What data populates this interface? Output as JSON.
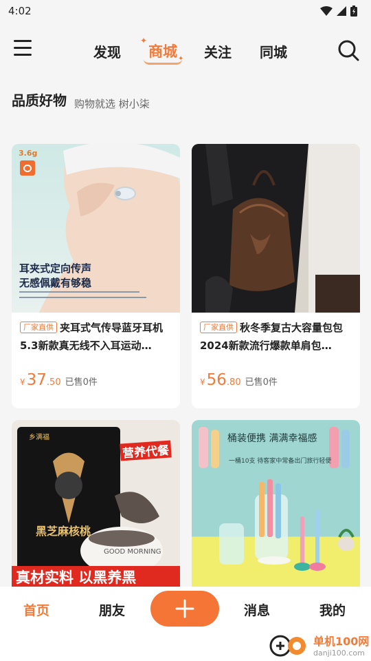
{
  "status_bar": {
    "time": "4:02"
  },
  "top_nav": {
    "tabs": [
      {
        "label": "发现"
      },
      {
        "label": "商城"
      },
      {
        "label": "关注"
      },
      {
        "label": "同城"
      }
    ],
    "active_tab": "商城"
  },
  "section": {
    "title": "品质好物",
    "subtitle": "购物就选 树小柒"
  },
  "products": [
    {
      "tag": "厂家直供",
      "title": "夹耳式气传导蓝牙耳机5.3新款真无线不入耳运动…",
      "price_symbol": "¥",
      "price_int": "37",
      "price_dec": ".50",
      "sold": "已售0件",
      "image_text": {
        "weight": "3.6g",
        "line1": "耳夹式定向传声",
        "line2": "无感佩戴有够稳"
      }
    },
    {
      "tag": "厂家直供",
      "title": "秋冬季复古大容量包包2024新款流行爆款单肩包…",
      "price_symbol": "¥",
      "price_int": "56",
      "price_dec": ".80",
      "sold": "已售0件"
    },
    {
      "image_text": {
        "brand": "乡满福",
        "badge": "营养代餐",
        "product": "黑芝麻核桃",
        "banner": "真材实料 以黑养黑",
        "cup": "GOOD MORNING"
      }
    },
    {
      "image_text": {
        "headline": "桶装便携 满满幸福感",
        "sub": "一桶10支 待客家中常备出门旅行轻便"
      }
    }
  ],
  "bottom_tabs": {
    "home": "首页",
    "friends": "朋友",
    "messages": "消息",
    "mine": "我的"
  },
  "watermark": {
    "name": "单机100网",
    "url": "danji100.com"
  },
  "colors": {
    "accent": "#f07b3a",
    "add_button": "#f47536"
  }
}
